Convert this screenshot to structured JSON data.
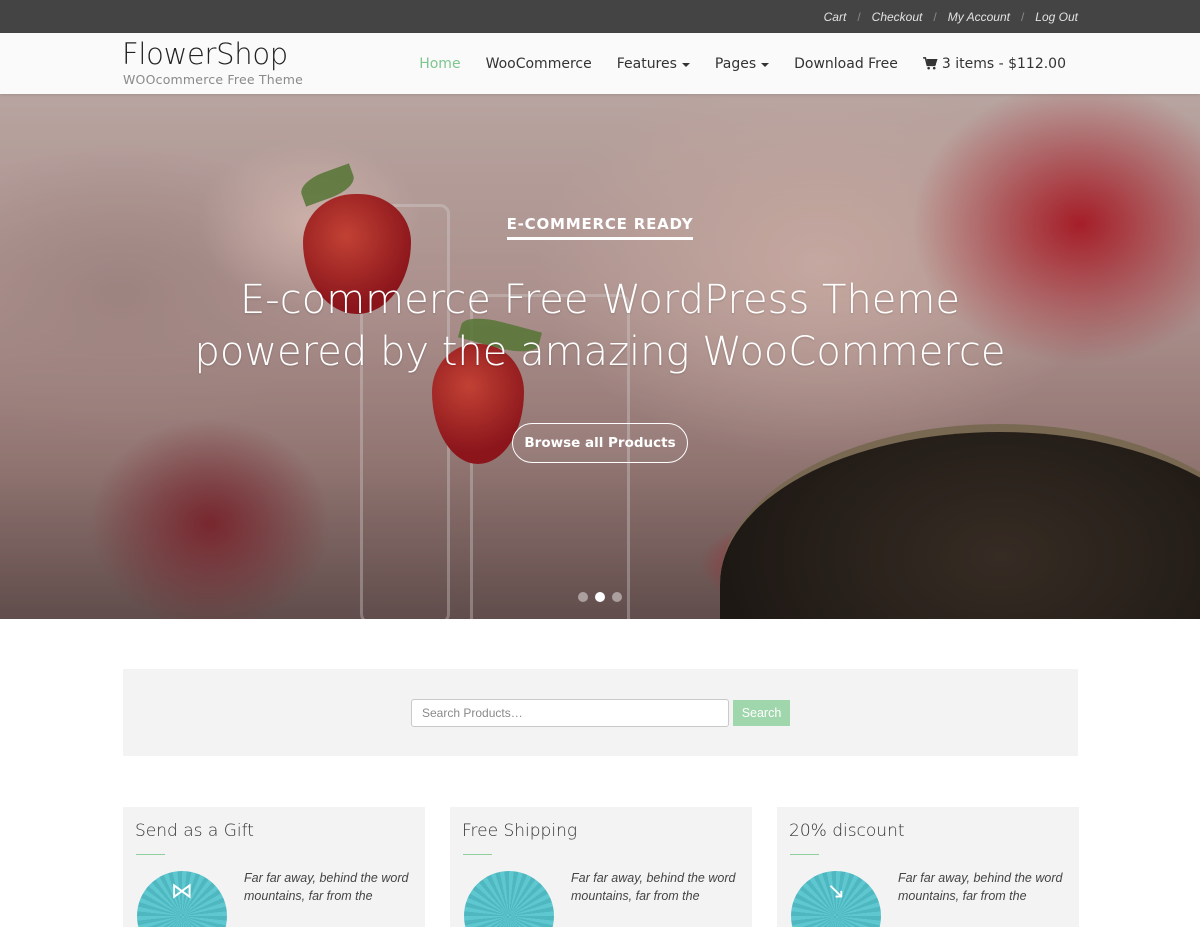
{
  "topbar": {
    "links": [
      "Cart",
      "Checkout",
      "My Account",
      "Log Out"
    ]
  },
  "header": {
    "logo_title": "FlowerShop",
    "logo_subtitle": "WOOcommerce Free Theme",
    "nav": [
      {
        "label": "Home",
        "active": true,
        "dropdown": false
      },
      {
        "label": "WooCommerce",
        "active": false,
        "dropdown": false
      },
      {
        "label": "Features",
        "active": false,
        "dropdown": true
      },
      {
        "label": "Pages",
        "active": false,
        "dropdown": true
      },
      {
        "label": "Download Free",
        "active": false,
        "dropdown": false
      }
    ],
    "cart_label": "3 items - $112.00",
    "cart_icon": "cart-icon",
    "accent_color": "#7ec58e"
  },
  "hero": {
    "kicker": "E-COMMERCE READY",
    "title_line1": "E-commerce Free WordPress Theme",
    "title_line2": "powered by the amazing WooCommerce",
    "button_label": "Browse all Products",
    "slide_count": 3,
    "active_slide": 2
  },
  "search": {
    "placeholder": "Search Products…",
    "value": "",
    "button_label": "Search",
    "button_color": "#9fd6ab"
  },
  "features": [
    {
      "title": "Send as a Gift",
      "text": "Far far away, behind the word mountains, far from the",
      "icon": "bow-icon"
    },
    {
      "title": "Free Shipping",
      "text": "Far far away, behind the word mountains, far from the",
      "icon": "shipping-icon"
    },
    {
      "title": "20% discount",
      "text": "Far far away, behind the word mountains, far from the",
      "icon": "discount-icon"
    }
  ]
}
